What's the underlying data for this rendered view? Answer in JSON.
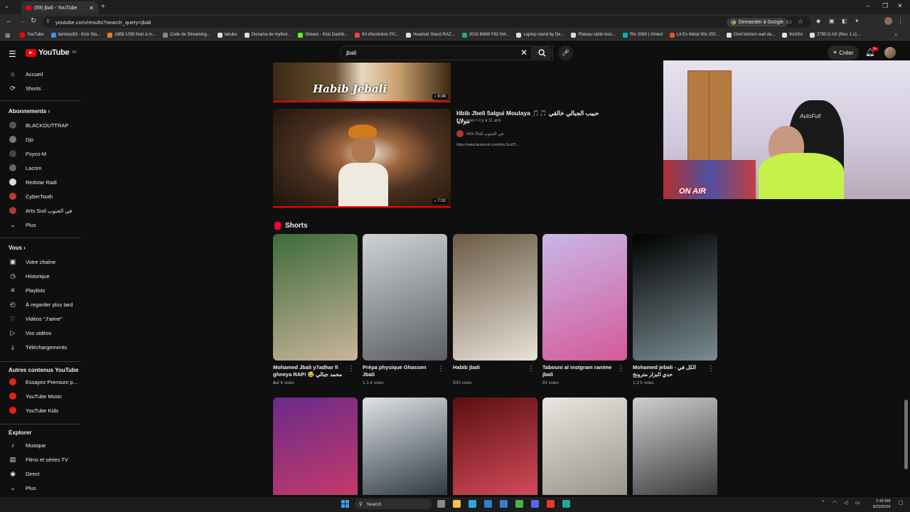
{
  "browser": {
    "tab_title": "(59) jbali - YouTube",
    "url": "youtube.com/results?search_query=jbali",
    "google_btn": "Demander à Google",
    "bookmarks": [
      {
        "label": "YouTube",
        "color": "#ff0000"
      },
      {
        "label": "laminox93 - Kick Sta...",
        "color": "#4a90e2"
      },
      {
        "label": "16Bit USB frein à m...",
        "color": "#e67e22"
      },
      {
        "label": "Code de Streaming...",
        "color": "#888888"
      },
      {
        "label": "labubu",
        "color": "#dddddd"
      },
      {
        "label": "Diorama de mythol...",
        "color": "#dddddd"
      },
      {
        "label": "Stream - Kick Dashb...",
        "color": "#53fc18"
      },
      {
        "label": "Kit d'évolution PC...",
        "color": "#e74c3c"
      },
      {
        "label": "Headset Stand RAZ...",
        "color": "#dddddd"
      },
      {
        "label": "2015 BMW F82 M4...",
        "color": "#27ae60"
      },
      {
        "label": "Laptop stand by De...",
        "color": "#dddddd"
      },
      {
        "label": "Plateau table bois...",
        "color": "#dddddd"
      },
      {
        "label": "Rtx 2060 | Vinted",
        "color": "#09b1ba"
      },
      {
        "label": "Lit En Métal 90x 200...",
        "color": "#e74c3c"
      },
      {
        "label": "Chef kitchen wall de...",
        "color": "#dddddd"
      },
      {
        "label": "KickSo",
        "color": "#dddddd"
      },
      {
        "label": "2790 D AX (Rev. 1.x)...",
        "color": "#dddddd"
      }
    ]
  },
  "header": {
    "logo": "YouTube",
    "logo_sup": "FR",
    "search_value": "jbali",
    "create_label": "Créer",
    "bell_badge": "9+"
  },
  "sidebar": {
    "main": [
      {
        "label": "Accueil",
        "icon": "home-icon",
        "glyph": "⌂"
      },
      {
        "label": "Shorts",
        "icon": "shorts-icon",
        "glyph": "⟳"
      }
    ],
    "subs_title": "Abonnements",
    "subs": [
      {
        "label": "BLACKOUTTRAP",
        "color": "#555555"
      },
      {
        "label": "Djo",
        "color": "#777777"
      },
      {
        "label": "Psyco-M",
        "color": "#444444"
      },
      {
        "label": "Lacrim",
        "color": "#666666"
      },
      {
        "label": "Redstar Radi",
        "color": "#dddddd"
      },
      {
        "label": "CyberTooth",
        "color": "#c0392b"
      },
      {
        "label": "Arts Sud في الجنوب",
        "color": "#b03a2e"
      },
      {
        "label": "Plus",
        "color": "none"
      }
    ],
    "you_title": "Vous",
    "you": [
      {
        "label": "Votre chaîne",
        "glyph": "▣"
      },
      {
        "label": "Historique",
        "glyph": "◷"
      },
      {
        "label": "Playlists",
        "glyph": "≡"
      },
      {
        "label": "À regarder plus tard",
        "glyph": "◴"
      },
      {
        "label": "Vidéos \"J'aime\"",
        "glyph": "♡"
      },
      {
        "label": "Vos vidéos",
        "glyph": "▷"
      },
      {
        "label": "Téléchargements",
        "glyph": "⤓"
      }
    ],
    "other_title": "Autres contenus YouTube",
    "other": [
      {
        "label": "Essayez Premium p..."
      },
      {
        "label": "YouTube Music"
      },
      {
        "label": "YouTube Kids"
      }
    ],
    "explore_title": "Explorer",
    "explore": [
      {
        "label": "Musique",
        "glyph": "♪"
      },
      {
        "label": "Films et séries TV",
        "glyph": "▤"
      },
      {
        "label": "Direct",
        "glyph": "◉"
      },
      {
        "label": "Plus",
        "glyph": "⌄"
      }
    ]
  },
  "results": {
    "video1": {
      "duration": "9:08",
      "overlay_text": "Habib Jebali"
    },
    "video2": {
      "title": "Hbib Jbeli 5algui Moulaya 🎵🎵 حبيب الجبالي خالقي مولايا",
      "meta": "26 k vues • il y a 11 ans",
      "channel": "Arts Sud في الجنوب",
      "desc": "https://www.facebook.com/Arts.Sud75 ...",
      "duration": "7:02"
    },
    "shorts_label": "Shorts",
    "shorts_row1": [
      {
        "title": "Mohamed Jbali y7adhar fi ghneya RAP! 😂 محمد جبالي ...",
        "views": "3,2 k vues",
        "c1": "#3d6b3a",
        "c2": "#c9b49a"
      },
      {
        "title": "Prépa physique Ghassen Jbali",
        "views": "1,1 k vues",
        "c1": "#cfd3d6",
        "c2": "#5b5f63"
      },
      {
        "title": "Habib jbali",
        "views": "500 vues",
        "c1": "#6b5a45",
        "c2": "#e8e2d8"
      },
      {
        "title": "Tabouni al instgram ranime jbali",
        "views": "91 vues",
        "c1": "#c9b6e8",
        "c2": "#d45a9a"
      },
      {
        "title": "Mohamed jebali - الكل في حدي البزار مترونخ",
        "views": "1,3 k vues",
        "c1": "#000000",
        "c2": "#7a8c92"
      }
    ],
    "shorts_row2": [
      {
        "c1": "#6a2a8a",
        "c2": "#c43a6a"
      },
      {
        "c1": "#dfe3e6",
        "c2": "#2f3a44"
      },
      {
        "c1": "#5a1010",
        "c2": "#d44a5a"
      },
      {
        "c1": "#e8e6e0",
        "c2": "#9a9488"
      },
      {
        "c1": "#cfcfcf",
        "c2": "#3a3a3a"
      }
    ]
  },
  "webcam": {
    "overlay": "ON AIR",
    "chair_brand": "AutoFull"
  },
  "taskbar": {
    "search": "Search",
    "time": "2:43 AM",
    "date": "8/23/2026"
  }
}
